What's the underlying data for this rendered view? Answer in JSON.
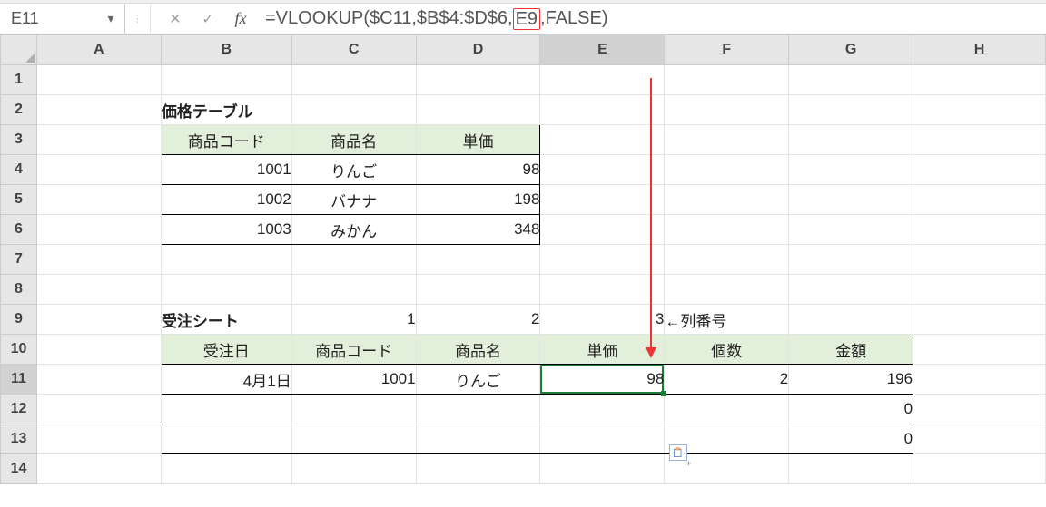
{
  "formula_bar": {
    "namebox": "E11",
    "fx_label": "fx",
    "formula_prefix": "=VLOOKUP($C11,$B$4:$D$6,",
    "formula_highlight": "E9",
    "formula_suffix": ",FALSE)"
  },
  "columns": [
    "A",
    "B",
    "C",
    "D",
    "E",
    "F",
    "G",
    "H"
  ],
  "rows": [
    "1",
    "2",
    "3",
    "4",
    "5",
    "6",
    "7",
    "8",
    "9",
    "10",
    "11",
    "12",
    "13",
    "14"
  ],
  "price_table": {
    "title": "価格テーブル",
    "headers": [
      "商品コード",
      "商品名",
      "単価"
    ],
    "rows": [
      {
        "code": "1001",
        "name": "りんご",
        "price": "98"
      },
      {
        "code": "1002",
        "name": "バナナ",
        "price": "198"
      },
      {
        "code": "1003",
        "name": "みかん",
        "price": "348"
      }
    ]
  },
  "order_sheet": {
    "title": "受注シート",
    "col_numbers": [
      "1",
      "2",
      "3"
    ],
    "col_number_note": "←列番号",
    "headers": [
      "受注日",
      "商品コード",
      "商品名",
      "単価",
      "個数",
      "金額"
    ],
    "rows": [
      {
        "date": "4月1日",
        "code": "1001",
        "name": "りんご",
        "price": "98",
        "qty": "2",
        "amount": "196"
      },
      {
        "date": "",
        "code": "",
        "name": "",
        "price": "",
        "qty": "",
        "amount": "0"
      },
      {
        "date": "",
        "code": "",
        "name": "",
        "price": "",
        "qty": "",
        "amount": "0"
      }
    ]
  },
  "annotations": {
    "highlight_ref": "E9"
  },
  "chart_data": {
    "type": "table",
    "tables": [
      {
        "name": "価格テーブル",
        "range": "B3:D6",
        "columns": [
          "商品コード",
          "商品名",
          "単価"
        ],
        "data": [
          [
            1001,
            "りんご",
            98
          ],
          [
            1002,
            "バナナ",
            198
          ],
          [
            1003,
            "みかん",
            348
          ]
        ]
      },
      {
        "name": "受注シート",
        "range": "B10:G13",
        "columns": [
          "受注日",
          "商品コード",
          "商品名",
          "単価",
          "個数",
          "金額"
        ],
        "data": [
          [
            "4月1日",
            1001,
            "りんご",
            98,
            2,
            196
          ],
          [
            "",
            "",
            "",
            "",
            "",
            0
          ],
          [
            "",
            "",
            "",
            "",
            "",
            0
          ]
        ]
      }
    ],
    "annotation": {
      "arrow_from": "FormulaBar E9 argument",
      "arrow_to": "Cell E9 (value 3)",
      "note": "←列番号"
    }
  }
}
